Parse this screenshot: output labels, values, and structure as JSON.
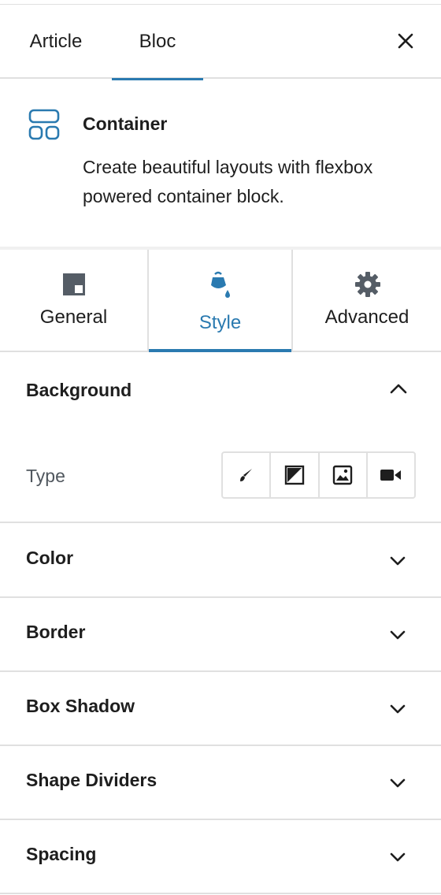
{
  "header": {
    "tabs": [
      {
        "label": "Article"
      },
      {
        "label": "Bloc"
      }
    ],
    "close_icon": "close-icon"
  },
  "block": {
    "title": "Container",
    "description": "Create beautiful layouts with flexbox powered container block.",
    "icon": "container-layout-icon",
    "accent": "#2a7ab0"
  },
  "inspector_tabs": [
    {
      "label": "General",
      "icon": "general-layout-icon"
    },
    {
      "label": "Style",
      "icon": "paint-bucket-icon"
    },
    {
      "label": "Advanced",
      "icon": "gear-icon"
    }
  ],
  "background_panel": {
    "title": "Background",
    "type_label": "Type",
    "type_options": [
      "brush-icon",
      "gradient-icon",
      "image-icon",
      "video-icon"
    ]
  },
  "panels": [
    {
      "title": "Color"
    },
    {
      "title": "Border"
    },
    {
      "title": "Box Shadow"
    },
    {
      "title": "Shape Dividers"
    },
    {
      "title": "Spacing"
    }
  ]
}
